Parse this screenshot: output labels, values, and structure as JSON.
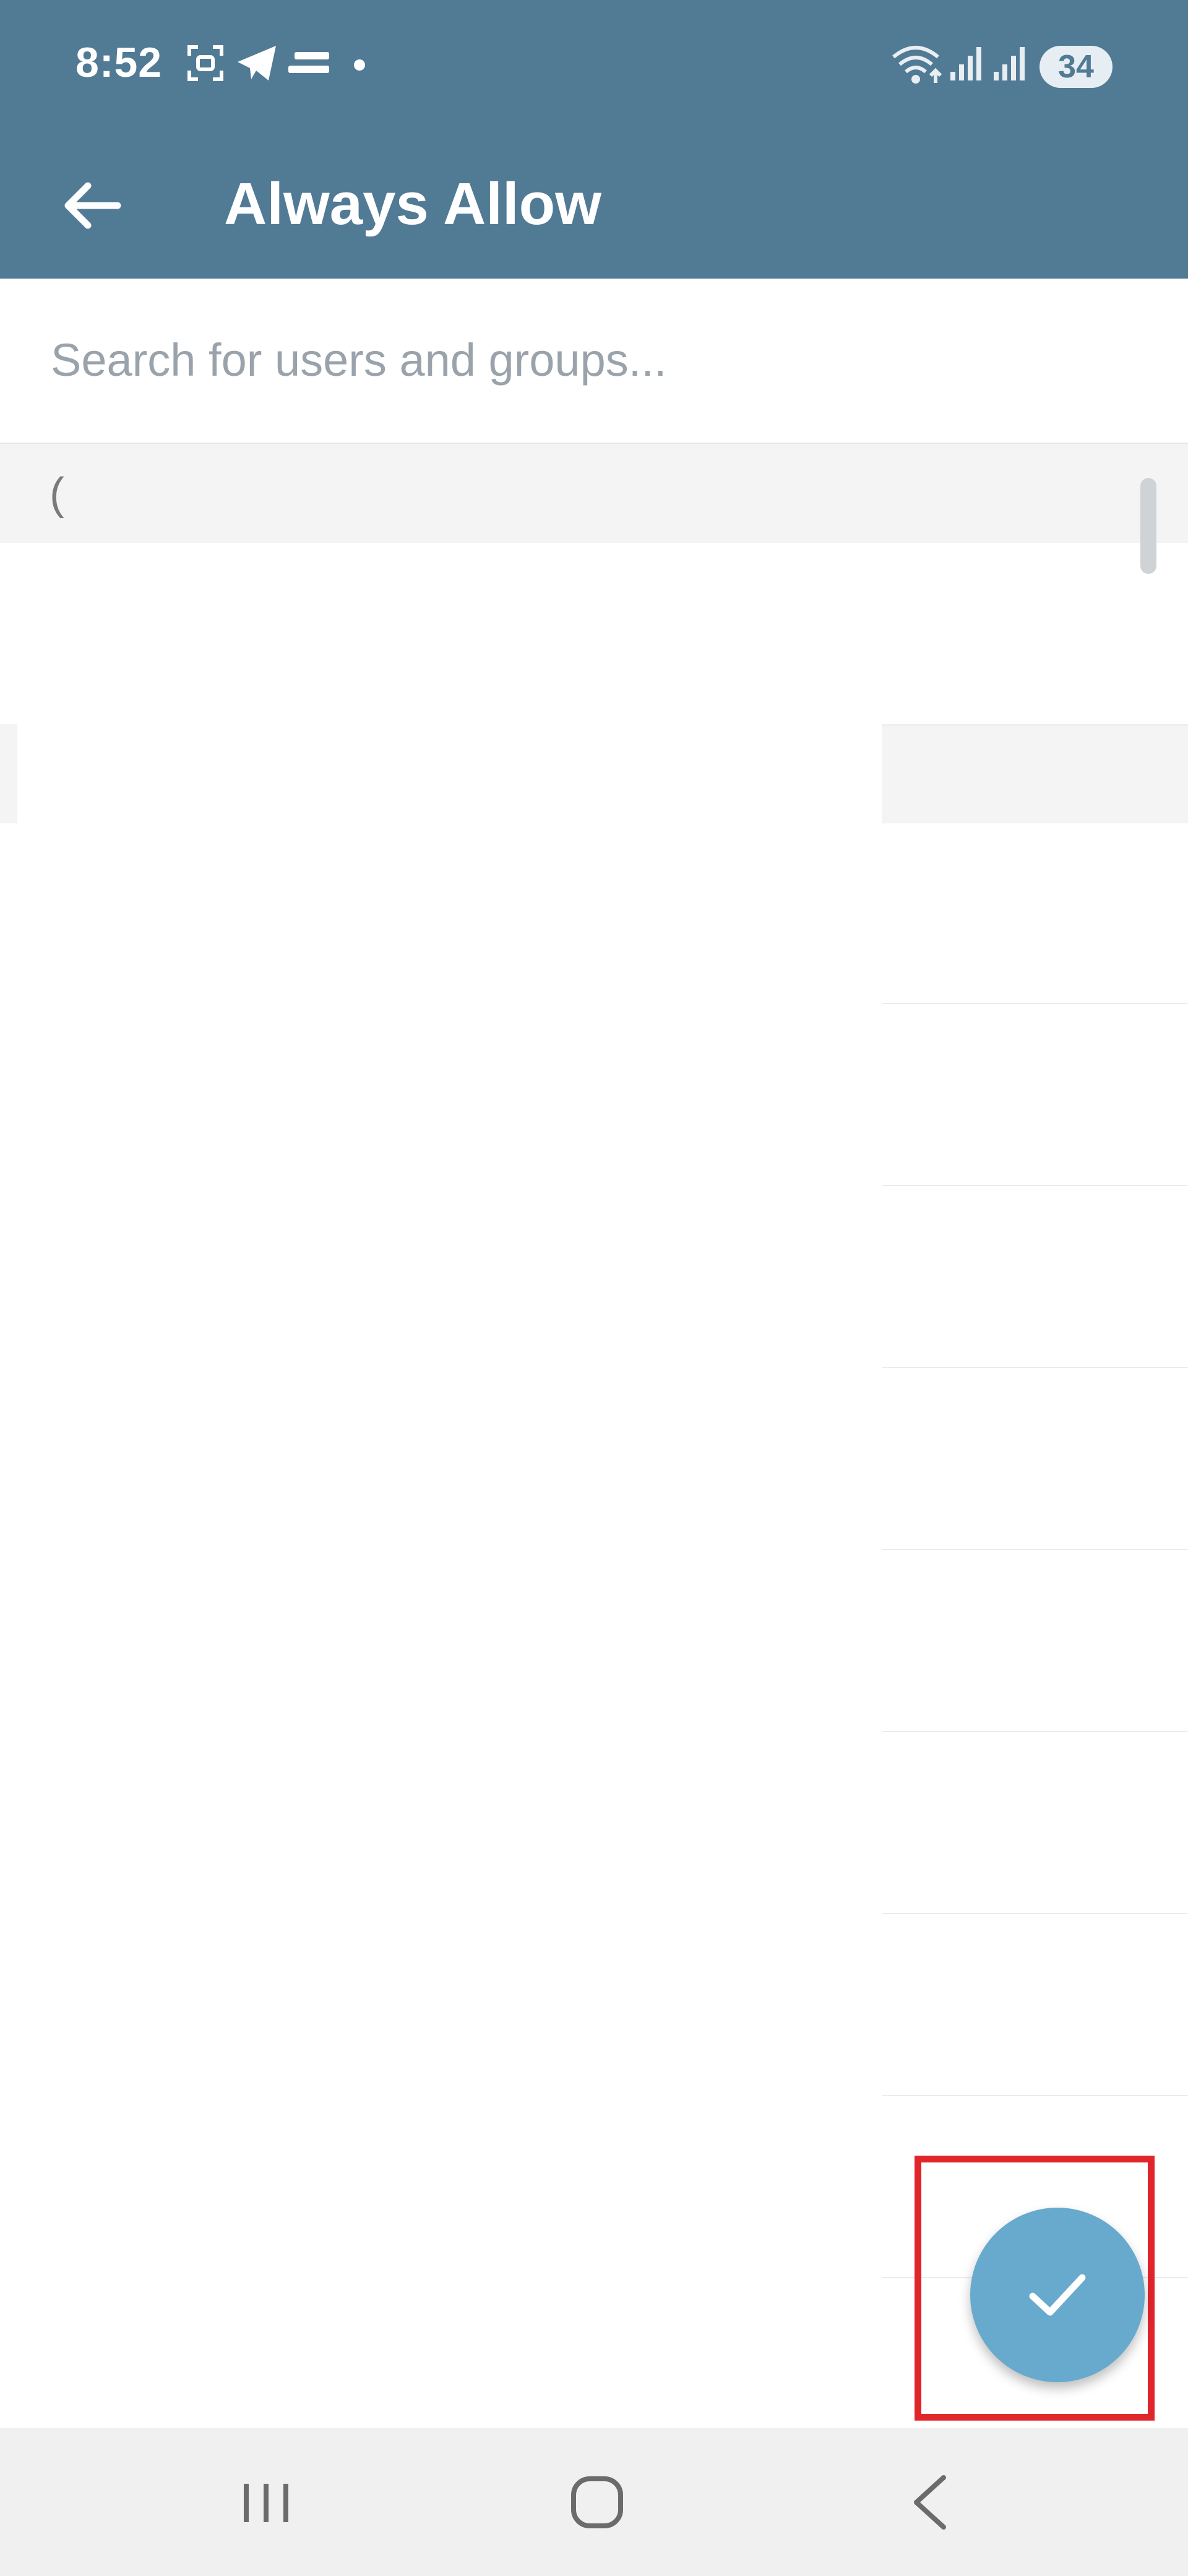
{
  "status_bar": {
    "time": "8:52",
    "battery": "34",
    "icons": [
      "screenshot-icon",
      "telegram-icon",
      "equal-icon",
      "dot-icon",
      "wifi-icon",
      "signal-icon",
      "signal-icon-2"
    ]
  },
  "toolbar": {
    "title": "Always Allow",
    "back_icon": "arrow-left-icon"
  },
  "search": {
    "placeholder": "Search for users and groups...",
    "value": ""
  },
  "section": {
    "header": "("
  },
  "fab": {
    "icon": "check-icon",
    "color": "#67aacd",
    "highlight_color": "#e0252b"
  },
  "nav": {
    "icons": [
      "recents-icon",
      "home-icon",
      "back-icon"
    ]
  },
  "colors": {
    "accent": "#517a95"
  }
}
